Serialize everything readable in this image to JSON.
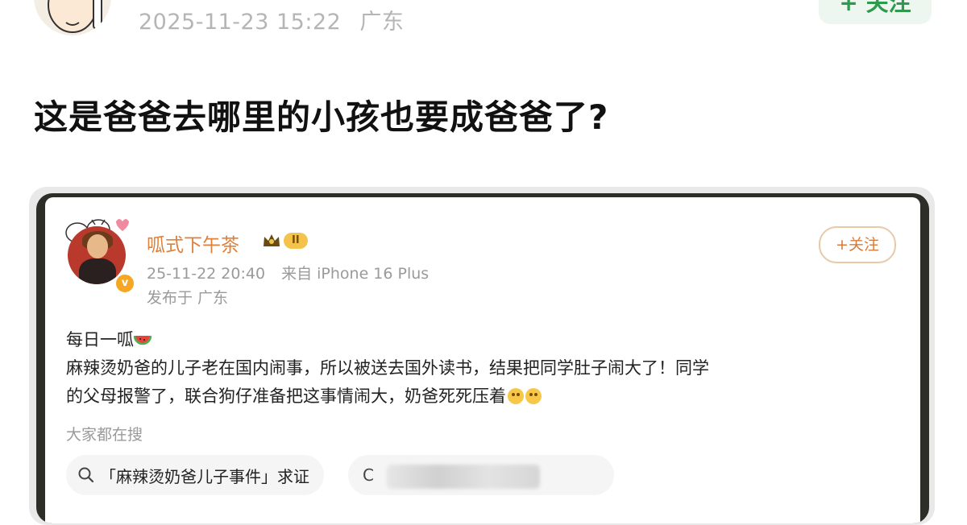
{
  "post": {
    "timestamp": "2025-11-23 15:22",
    "location": "广东",
    "follow_label": "+ 关注",
    "title": "这是爸爸去哪里的小孩也要成爸爸了?"
  },
  "embedded": {
    "username": "呱式下午茶",
    "level_badge": "II",
    "follow_label": "+关注",
    "time": "25-11-22 20:40",
    "source": "来自 iPhone 16 Plus",
    "published": "发布于 广东",
    "body_line1": "每日一呱",
    "body_line2": "麻辣烫奶爸的儿子老在国内闹事，所以被送去国外读书，结果把同学肚子闹大了！同学",
    "body_line3": "的父母报警了，联合狗仔准备把这事情闹大，奶爸死死压着",
    "search_label": "大家都在搜",
    "search_chip1": "「麻辣烫奶爸儿子事件」求证",
    "search_chip2_icon": "C"
  },
  "colors": {
    "accent_orange": "#e0803a",
    "follow_green": "#2e9a4d",
    "meta_grey": "#9a9a9a"
  },
  "icons": [
    "avatar",
    "crown-icon",
    "verified-icon",
    "watermelon-emoji",
    "face-emoji",
    "search-icon"
  ]
}
